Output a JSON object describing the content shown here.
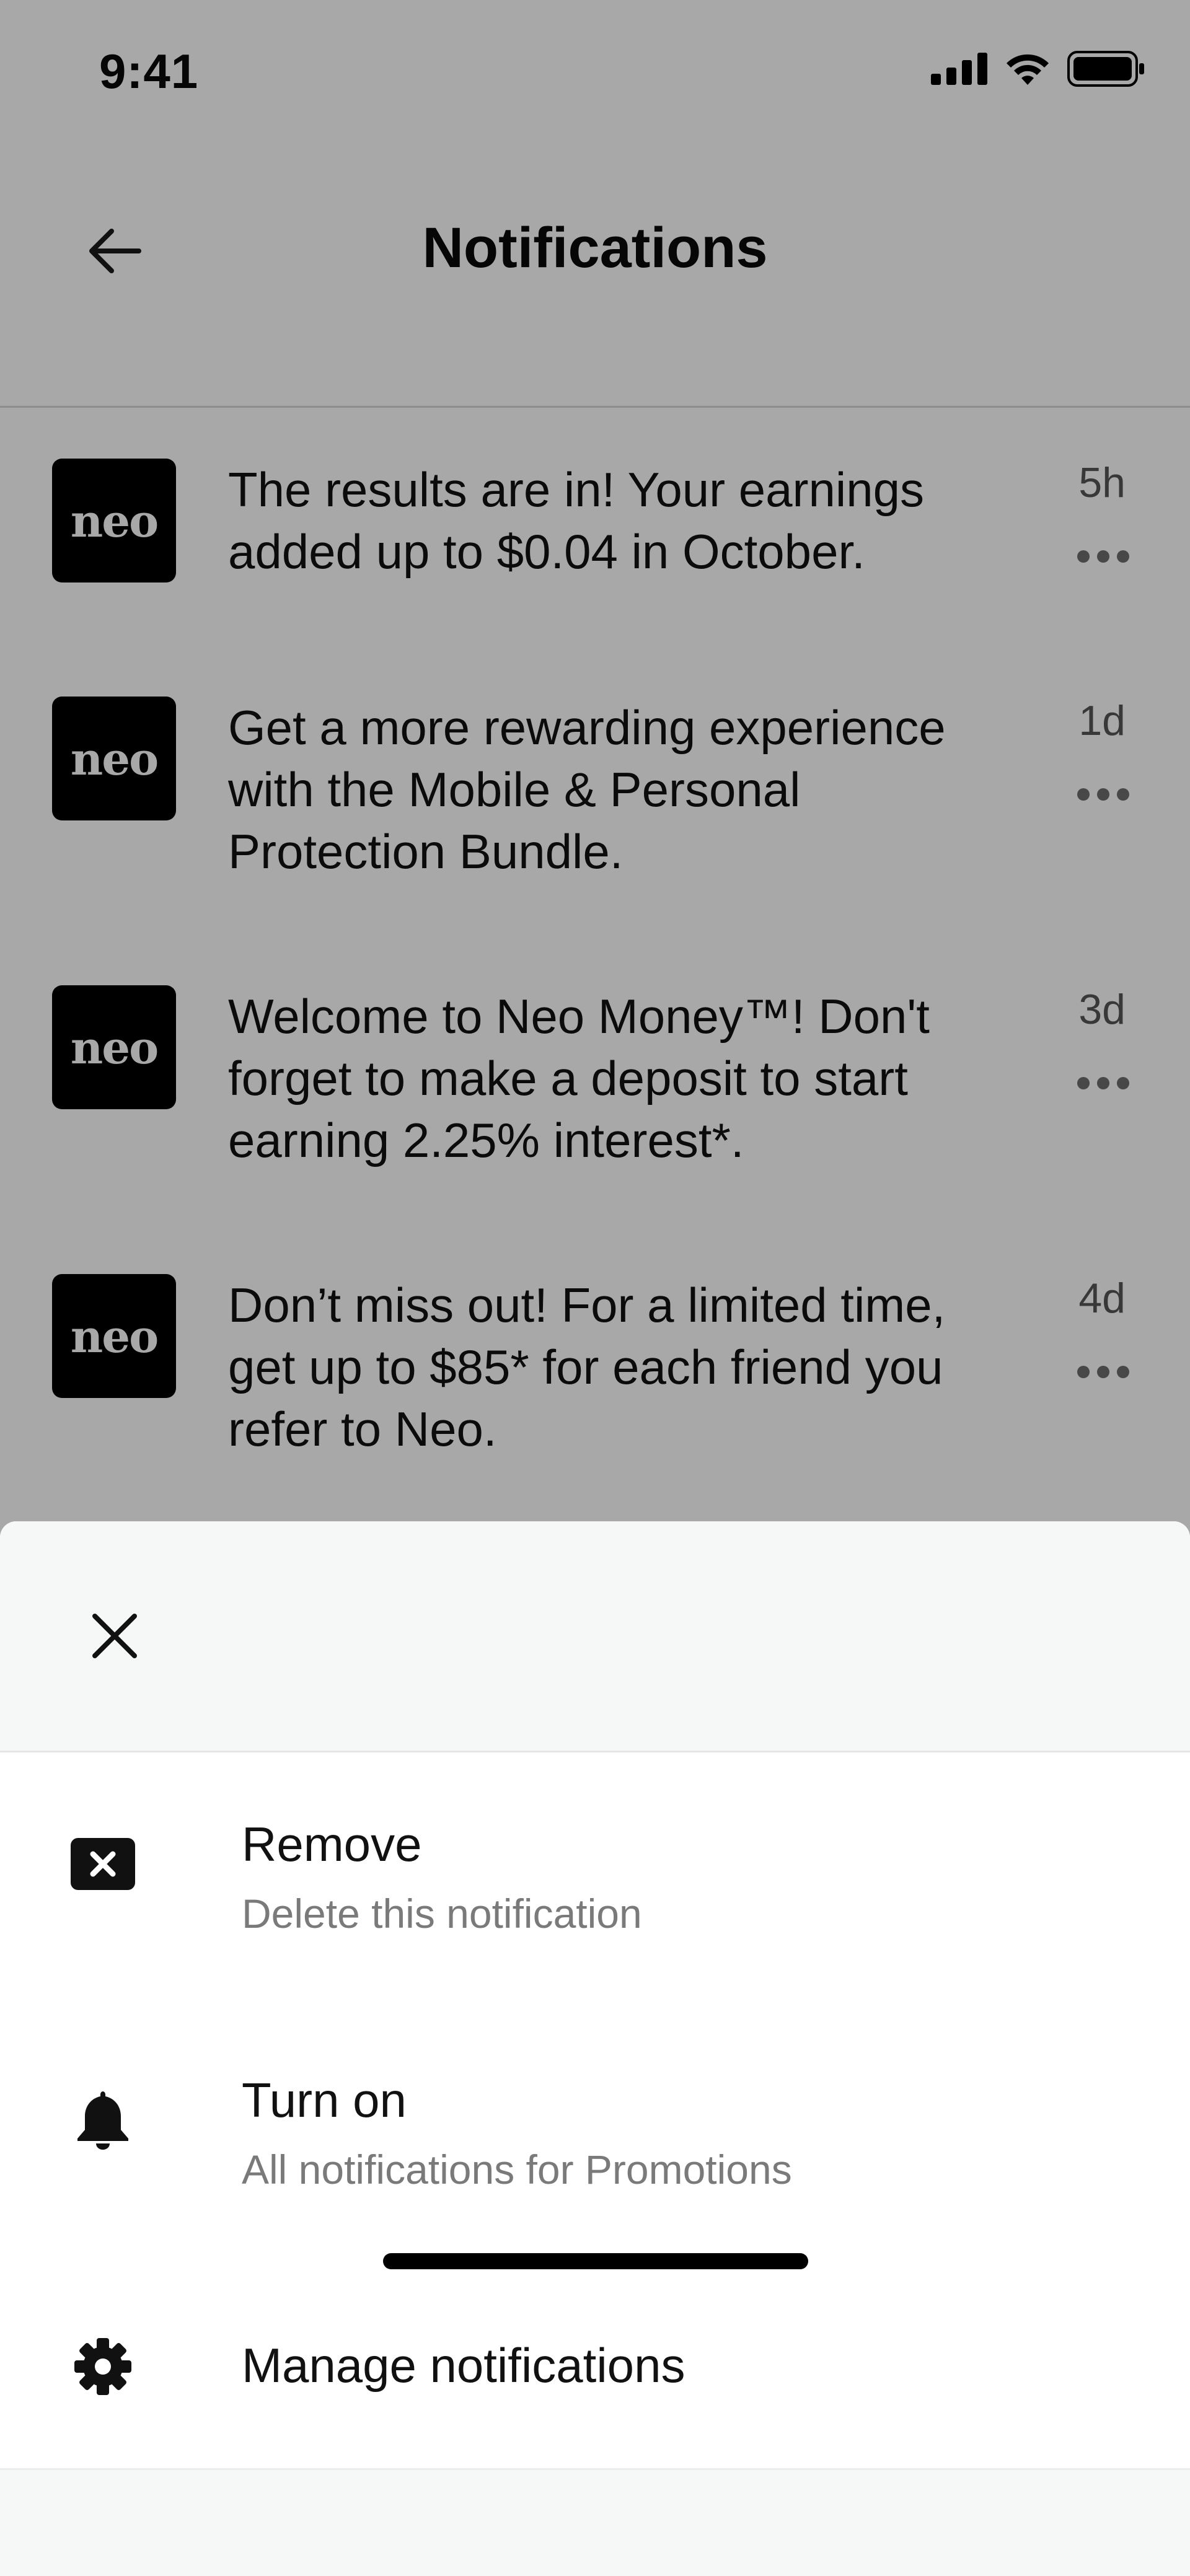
{
  "status_bar": {
    "time": "9:41"
  },
  "header": {
    "title": "Notifications"
  },
  "brand": {
    "logo_text": "neo"
  },
  "notifications": [
    {
      "text": "The results are in! Your earnings added up to $0.04 in October.",
      "time": "5h"
    },
    {
      "text": "Get a more rewarding experience with the Mobile & Personal Protection Bundle.",
      "time": "1d"
    },
    {
      "text": "Welcome to Neo Money™! Don't forget to make a deposit to start earning 2.25% interest*.",
      "time": "3d"
    },
    {
      "text": "Don’t miss out! For a limited time, get up to $85* for each friend you refer to Neo.",
      "time": "4d"
    }
  ],
  "sheet": {
    "actions": [
      {
        "title": "Remove",
        "subtitle": "Delete this notification",
        "icon": "remove-icon"
      },
      {
        "title": "Turn on",
        "subtitle": "All notifications for Promotions",
        "icon": "bell-icon"
      },
      {
        "title": "Manage notifications",
        "icon": "gear-icon"
      }
    ]
  },
  "colors": {
    "overlay": "rgba(0,0,0,0.34)",
    "sheet_header_bg": "#f6f7f7",
    "subtitle_gray": "#7a7a7a",
    "logo_bg": "#000000"
  }
}
